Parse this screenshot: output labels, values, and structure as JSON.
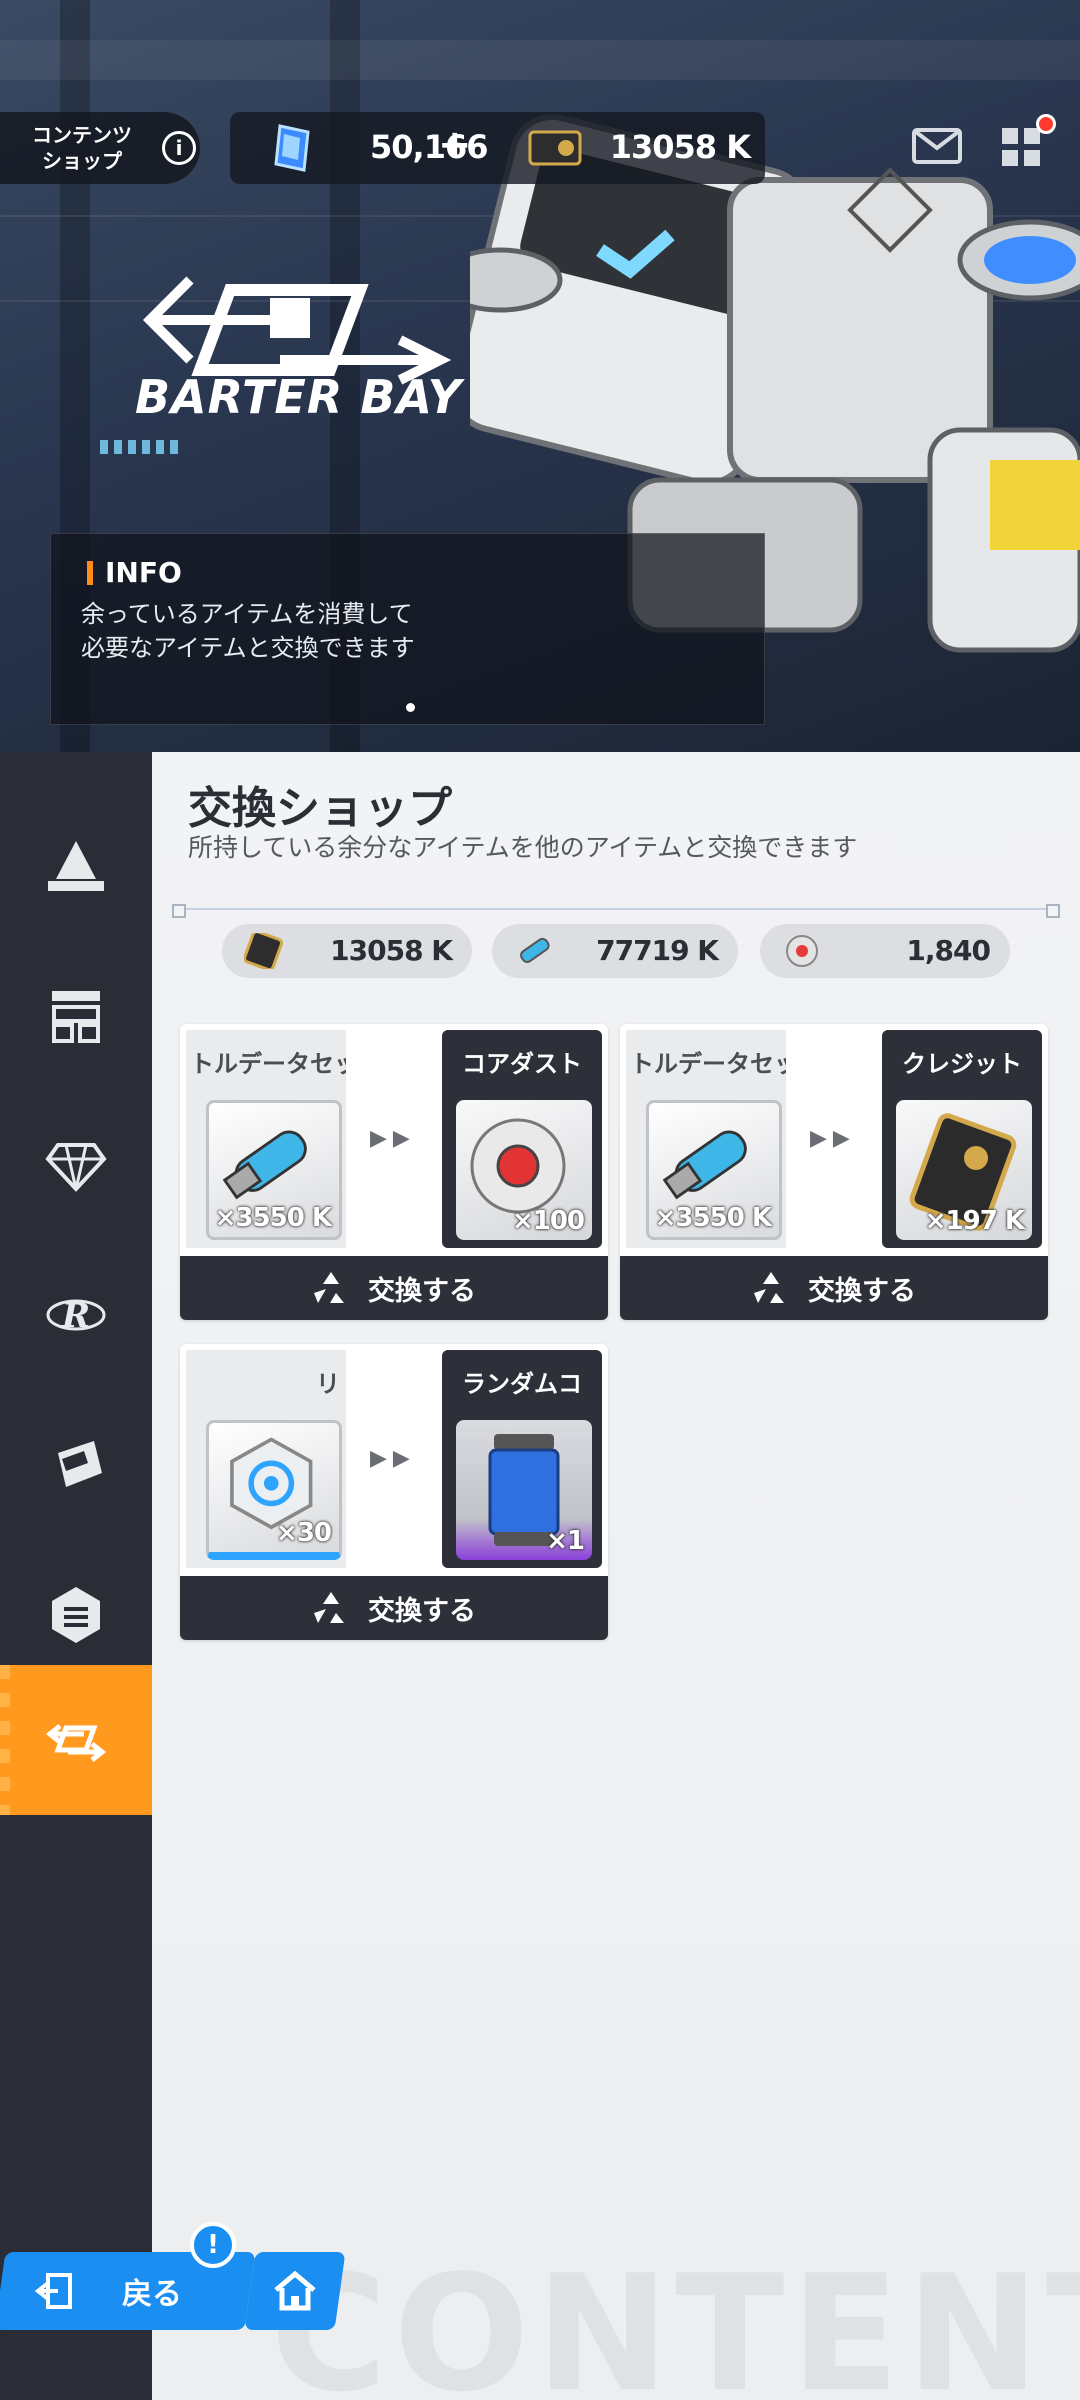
{
  "header": {
    "content_shop_label": "コンテンツ\nショップ",
    "info_icon": "info-icon",
    "gem_amount": "50,166",
    "plus_label": "+",
    "card_amount": "13058 K",
    "mail_icon": "mail-icon",
    "menu_icon": "grid-menu-icon"
  },
  "hero": {
    "logo_text": "BARTER BAY",
    "info_title": "INFO",
    "info_line1": "余っているアイテムを消費して",
    "info_line2": "必要なアイテムと交換できます"
  },
  "sidebar": {
    "items": [
      {
        "icon": "outpost-icon"
      },
      {
        "icon": "shop-stall-icon"
      },
      {
        "icon": "diamond-icon"
      },
      {
        "icon": "recycle-r-icon"
      },
      {
        "icon": "ticket-icon"
      },
      {
        "icon": "hexagon-icon"
      },
      {
        "icon": "barter-arrows-icon",
        "active": true
      }
    ]
  },
  "main": {
    "title": "交換ショップ",
    "subtitle": "所持している余分なアイテムを他のアイテムと交換できます",
    "resources": [
      {
        "icon": "credit-card-icon",
        "value": "13058 K"
      },
      {
        "icon": "data-usb-icon",
        "value": "77719 K"
      },
      {
        "icon": "core-dust-icon",
        "value": "1,840"
      }
    ],
    "exchanges": [
      {
        "src_title": "トルデータセッ",
        "src_qty": "×3550 K",
        "arrows": "▶▶",
        "dst_title": "コアダスト",
        "dst_qty": "×100",
        "button": "交換する"
      },
      {
        "src_title": "トルデータセッ",
        "src_qty": "×3550 K",
        "arrows": "▶▶",
        "dst_title": "クレジット",
        "dst_qty": "×197 K",
        "button": "交換する"
      },
      {
        "src_title": "リ",
        "src_qty": "×30",
        "arrows": "▶▶",
        "dst_title": "ランダムコ",
        "dst_qty": "×1",
        "button": "交換する"
      }
    ],
    "watermark": "CONTENT"
  },
  "nav": {
    "back_label": "戻る",
    "alert_badge": "!",
    "home_icon": "home-icon"
  },
  "colors": {
    "accent_orange": "#ff9a1f",
    "nav_blue": "#1b8ef2",
    "dark_panel": "#2d3038"
  }
}
